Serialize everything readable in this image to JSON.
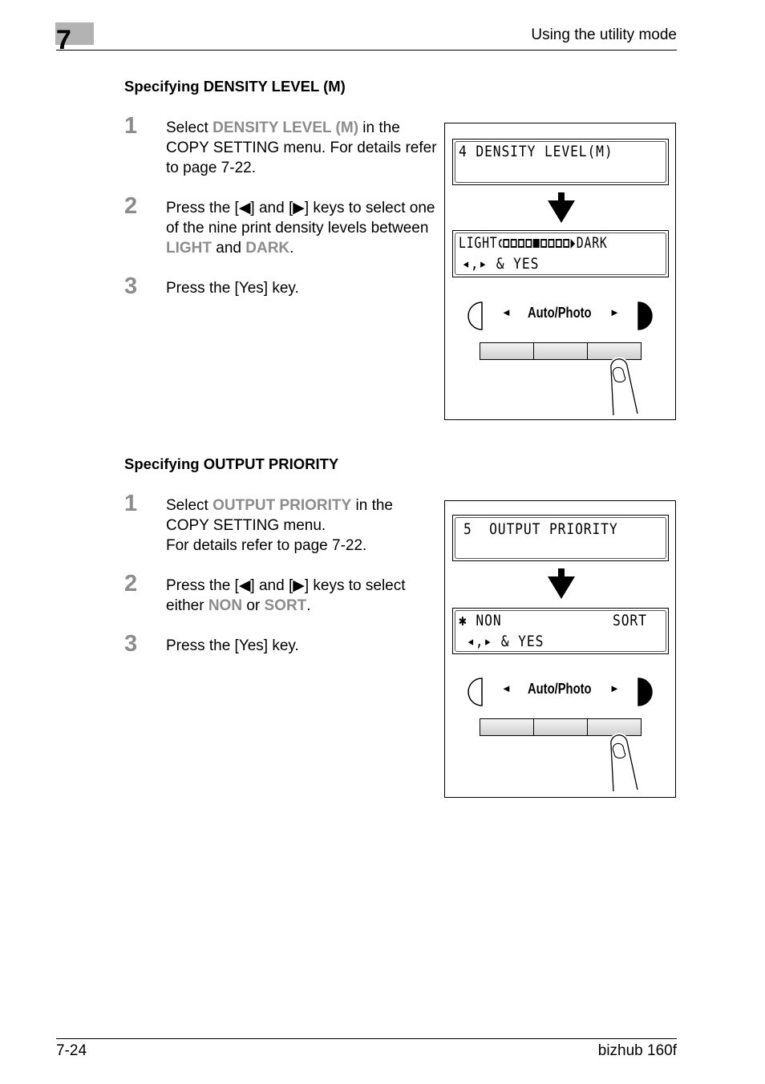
{
  "header": {
    "chapter_number": "7",
    "title": "Using the utility mode"
  },
  "sections": [
    {
      "title": "Specifying DENSITY LEVEL (M)",
      "steps": [
        {
          "number": "1",
          "parts": [
            "Select ",
            "DENSITY LEVEL (M)",
            " in the COPY SETTING menu. For details refer to page 7-22."
          ]
        },
        {
          "number": "2",
          "parts": [
            "Press the [◀] and [▶] keys to select one of the nine print density levels between ",
            "LIGHT",
            " and ",
            "DARK",
            "."
          ]
        },
        {
          "number": "3",
          "text": "Press the [Yes] key."
        }
      ],
      "illustration": {
        "lcd_before": {
          "line1": "4 DENSITY LEVEL(M)",
          "line2": ""
        },
        "lcd_after": {
          "left_label": "LIGHT",
          "right_label": "DARK",
          "density_levels": 9,
          "selected_level": 5,
          "line2": "◂,▸ & YES"
        },
        "key_label": "Auto/Photo",
        "key_left_arrow": "◄",
        "key_right_arrow": "►"
      }
    },
    {
      "title": "Specifying OUTPUT PRIORITY",
      "steps": [
        {
          "number": "1",
          "parts": [
            "Select ",
            "OUTPUT PRIORITY",
            " in the COPY SETTING menu.",
            "For details refer to page 7-22."
          ]
        },
        {
          "number": "2",
          "parts": [
            "Press the [◀] and [▶] keys to select either ",
            "NON",
            " or ",
            "SORT",
            "."
          ]
        },
        {
          "number": "3",
          "text": "Press the [Yes] key."
        }
      ],
      "illustration": {
        "lcd_before": {
          "line1": "5  OUTPUT PRIORITY",
          "line2": ""
        },
        "lcd_after": {
          "selected_marker": "✱",
          "option_left": "NON",
          "option_right": "SORT",
          "line2": "◂,▸ & YES"
        },
        "key_label": "Auto/Photo",
        "key_left_arrow": "◄",
        "key_right_arrow": "►"
      }
    }
  ],
  "footer": {
    "page_number": "7-24",
    "product_name": "bizhub 160f"
  },
  "colors": {
    "highlight": "#8c8c8c",
    "chapter_box": "#b3b3b3"
  }
}
